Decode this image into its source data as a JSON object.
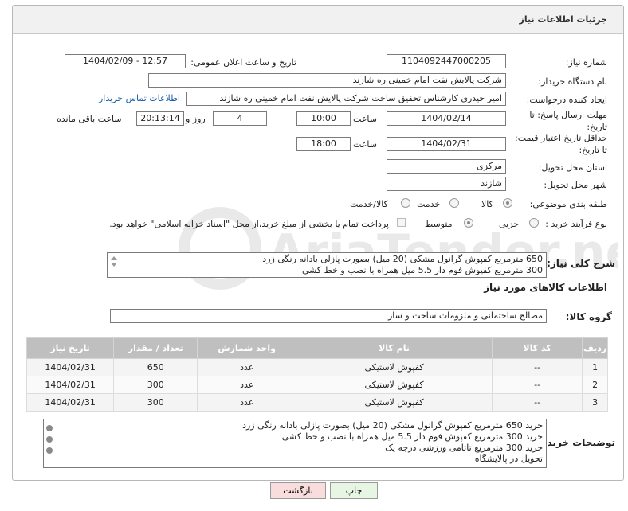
{
  "panel": {
    "title": "جزئیات اطلاعات نیاز"
  },
  "labels": {
    "need_number": "شماره نیاز:",
    "announce_datetime": "تاریخ و ساعت اعلان عمومی:",
    "buyer_org": "نام دستگاه خریدار:",
    "requester": "ایجاد کننده درخواست:",
    "reply_deadline": "مهلت ارسال پاسخ: تا تاریخ:",
    "price_validity": "حداقل تاریخ اعتبار قیمت: تا تاریخ:",
    "time": "ساعت",
    "time2": "ساعت",
    "day_and": "روز و",
    "remaining": "ساعت باقی مانده",
    "province": "استان محل تحویل:",
    "city": "شهر محل تحویل:",
    "category": "طبقه بندی موضوعی:",
    "process_type": "نوع فرآیند خرید :",
    "need_desc": "شرح کلی نیاز:",
    "goods_info": "اطلاعات کالاهای مورد نیاز",
    "goods_group": "گروه کالا:",
    "buyer_notes": "توضیحات خریدار:"
  },
  "fields": {
    "need_number": "1104092447000205",
    "announce_datetime": "1404/02/09 - 12:57",
    "buyer_org": "شرکت پالایش نفت امام خمینی  ره  شازند",
    "requester": "امیر  حیدری کارشناس تحقیق ساخت شرکت پالایش نفت امام خمینی  ره  شازند",
    "contact_link": "اطلاعات تماس خریدار",
    "reply_date": "1404/02/14",
    "reply_time": "10:00",
    "remaining_days": "4",
    "remaining_time": "20:13:14",
    "validity_date": "1404/02/31",
    "validity_time": "18:00",
    "province": "مرکزی",
    "city": "شازند",
    "goods_group": "مصالح ساختمانی و ملزومات ساخت و ساز"
  },
  "category_options": [
    {
      "label": "کالا",
      "selected": true
    },
    {
      "label": "خدمت",
      "selected": false
    },
    {
      "label": "کالا/خدمت",
      "selected": false
    }
  ],
  "process_options": [
    {
      "label": "جزیی",
      "selected": false
    },
    {
      "label": "متوسط",
      "selected": true
    }
  ],
  "payment_note": "پرداخت تمام یا بخشی از مبلغ خرید،از محل \"اسناد خزانه اسلامی\" خواهد بود.",
  "need_description": [
    "650 مترمربع کفپوش گرانول مشکی (20 میل) بصورت پازلی بادانه رنگی زرد",
    "300 مترمربع کفپوش فوم دار 5.5 میل همراه با نصب و خط کشی"
  ],
  "table": {
    "headers": [
      "ردیف",
      "کد کالا",
      "نام کالا",
      "واحد شمارش",
      "تعداد / مقدار",
      "تاریخ نیاز"
    ],
    "rows": [
      [
        "1",
        "--",
        "کفپوش لاستیکی",
        "عدد",
        "650",
        "1404/02/31"
      ],
      [
        "2",
        "--",
        "کفپوش لاستیکی",
        "عدد",
        "300",
        "1404/02/31"
      ],
      [
        "3",
        "--",
        "کفپوش لاستیکی",
        "عدد",
        "300",
        "1404/02/31"
      ]
    ]
  },
  "buyer_notes": [
    "خرید 650 مترمربع کفپوش گرانول مشکی (20 میل) بصورت پازلی بادانه رنگی زرد",
    "خرید 300 مترمربع کفپوش فوم دار 5.5 میل همراه با نصب و خط کشی",
    "خرید 300 مترمربع تاتامی ورزشی درجه یک",
    "تحویل در پالایشگاه"
  ],
  "buttons": {
    "print": "چاپ",
    "back": "بازگشت"
  },
  "watermark_text": "AriaTender.neT",
  "colors": {
    "link": "#1a5fa8",
    "table_header": "#bfbfbf",
    "print_button": "#e7f6e3",
    "back_button": "#f9dcdc"
  }
}
